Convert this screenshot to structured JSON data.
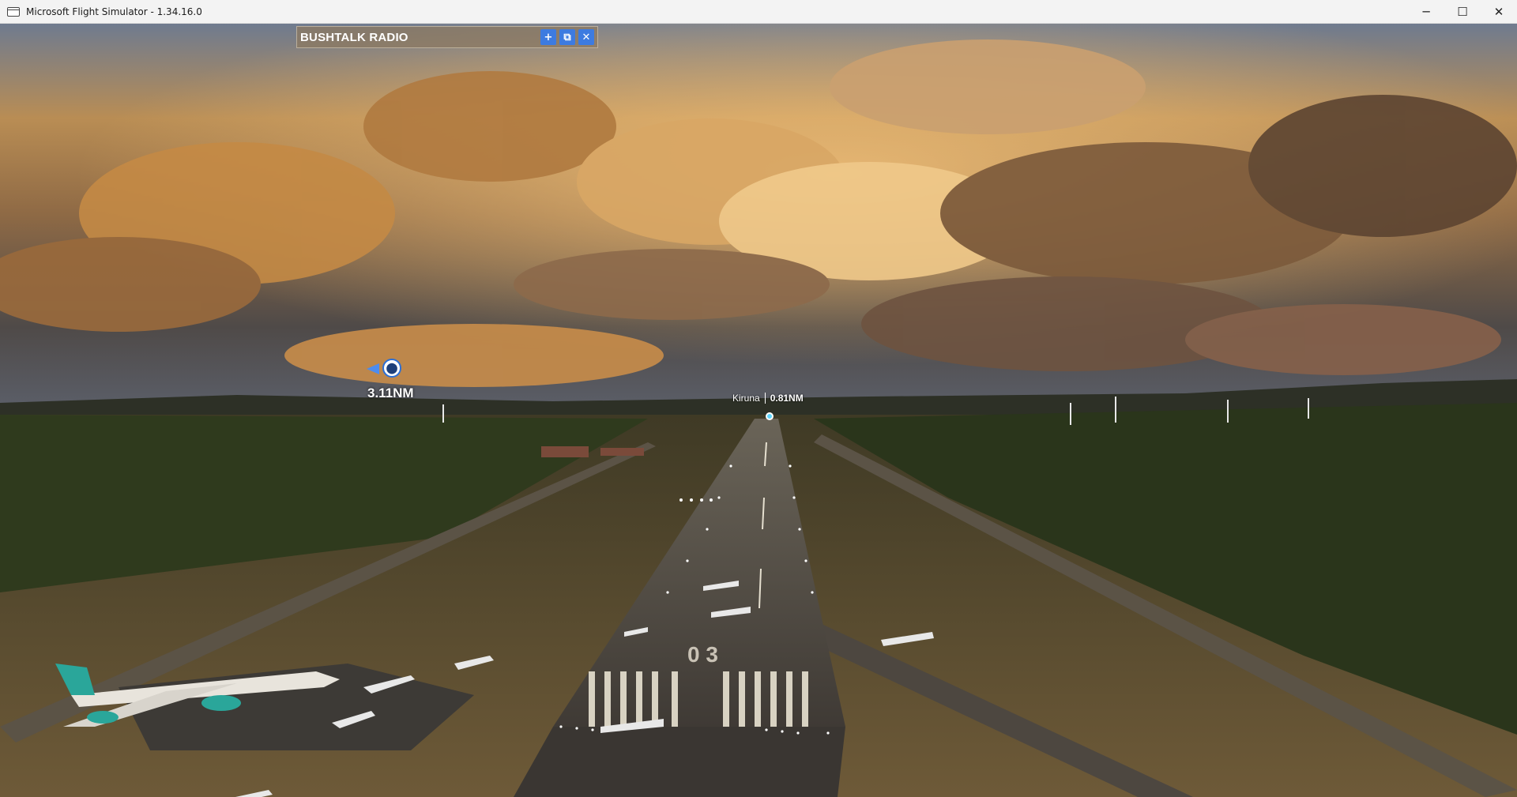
{
  "window": {
    "title": "Microsoft Flight Simulator - 1.34.16.0",
    "controls": [
      "─",
      "☐",
      "✕"
    ]
  },
  "bushtalk": {
    "title": "BUSHTALK RADIO",
    "buttons": [
      "+",
      "⧉",
      "✕"
    ]
  },
  "waypoint": {
    "distance": "3.11NM",
    "icon": "map-pin-icon"
  },
  "runway_marker": {
    "name": "Kiruna",
    "distance": "0.81NM"
  },
  "colors": {
    "panel_button": "#3d7be0",
    "ai_label": "#ff2a2a",
    "waypoint_accent": "#4c8cf0"
  }
}
